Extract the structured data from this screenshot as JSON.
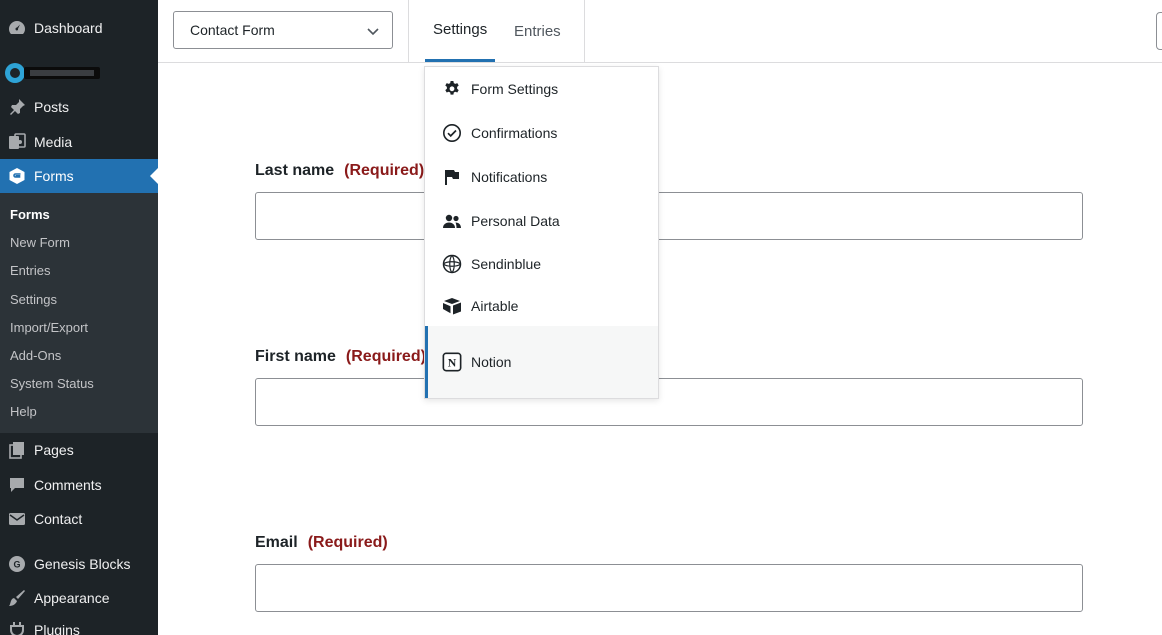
{
  "colors": {
    "sidebar_bg": "#1d2327",
    "submenu_bg": "#2c3338",
    "accent": "#2271b1",
    "required": "#8a1a1a"
  },
  "sidebar": {
    "menu": [
      {
        "label": "Dashboard",
        "icon": "dashboard-icon"
      },
      {
        "label": "Posts",
        "icon": "pin-icon"
      },
      {
        "label": "Media",
        "icon": "media-icon"
      },
      {
        "label": "Forms",
        "icon": "forms-icon",
        "active": true
      },
      {
        "label": "Pages",
        "icon": "pages-icon"
      },
      {
        "label": "Comments",
        "icon": "comment-icon"
      },
      {
        "label": "Contact",
        "icon": "mail-icon"
      },
      {
        "label": "Genesis Blocks",
        "icon": "genesis-icon"
      },
      {
        "label": "Appearance",
        "icon": "brush-icon"
      },
      {
        "label": "Plugins",
        "icon": "plugin-icon"
      }
    ],
    "submenu": [
      {
        "label": "Forms",
        "current": true
      },
      {
        "label": "New Form"
      },
      {
        "label": "Entries"
      },
      {
        "label": "Settings"
      },
      {
        "label": "Import/Export"
      },
      {
        "label": "Add-Ons"
      },
      {
        "label": "System Status"
      },
      {
        "label": "Help"
      }
    ]
  },
  "toolbar": {
    "form_select_value": "Contact Form",
    "tabs": [
      {
        "label": "Settings",
        "active": true
      },
      {
        "label": "Entries"
      }
    ]
  },
  "dropdown": {
    "items": [
      {
        "label": "Form Settings",
        "icon": "gear-icon"
      },
      {
        "label": "Confirmations",
        "icon": "check-circle-icon"
      },
      {
        "label": "Notifications",
        "icon": "flag-icon"
      },
      {
        "label": "Personal Data",
        "icon": "people-icon"
      },
      {
        "label": "Sendinblue",
        "icon": "sendinblue-icon"
      },
      {
        "label": "Airtable",
        "icon": "airtable-icon"
      },
      {
        "label": "Notion",
        "icon": "notion-icon",
        "selected": true
      }
    ]
  },
  "form": {
    "fields": [
      {
        "label": "Last name",
        "required": "(Required)"
      },
      {
        "label": "First name",
        "required": "(Required)"
      },
      {
        "label": "Email",
        "required": "(Required)"
      }
    ]
  }
}
